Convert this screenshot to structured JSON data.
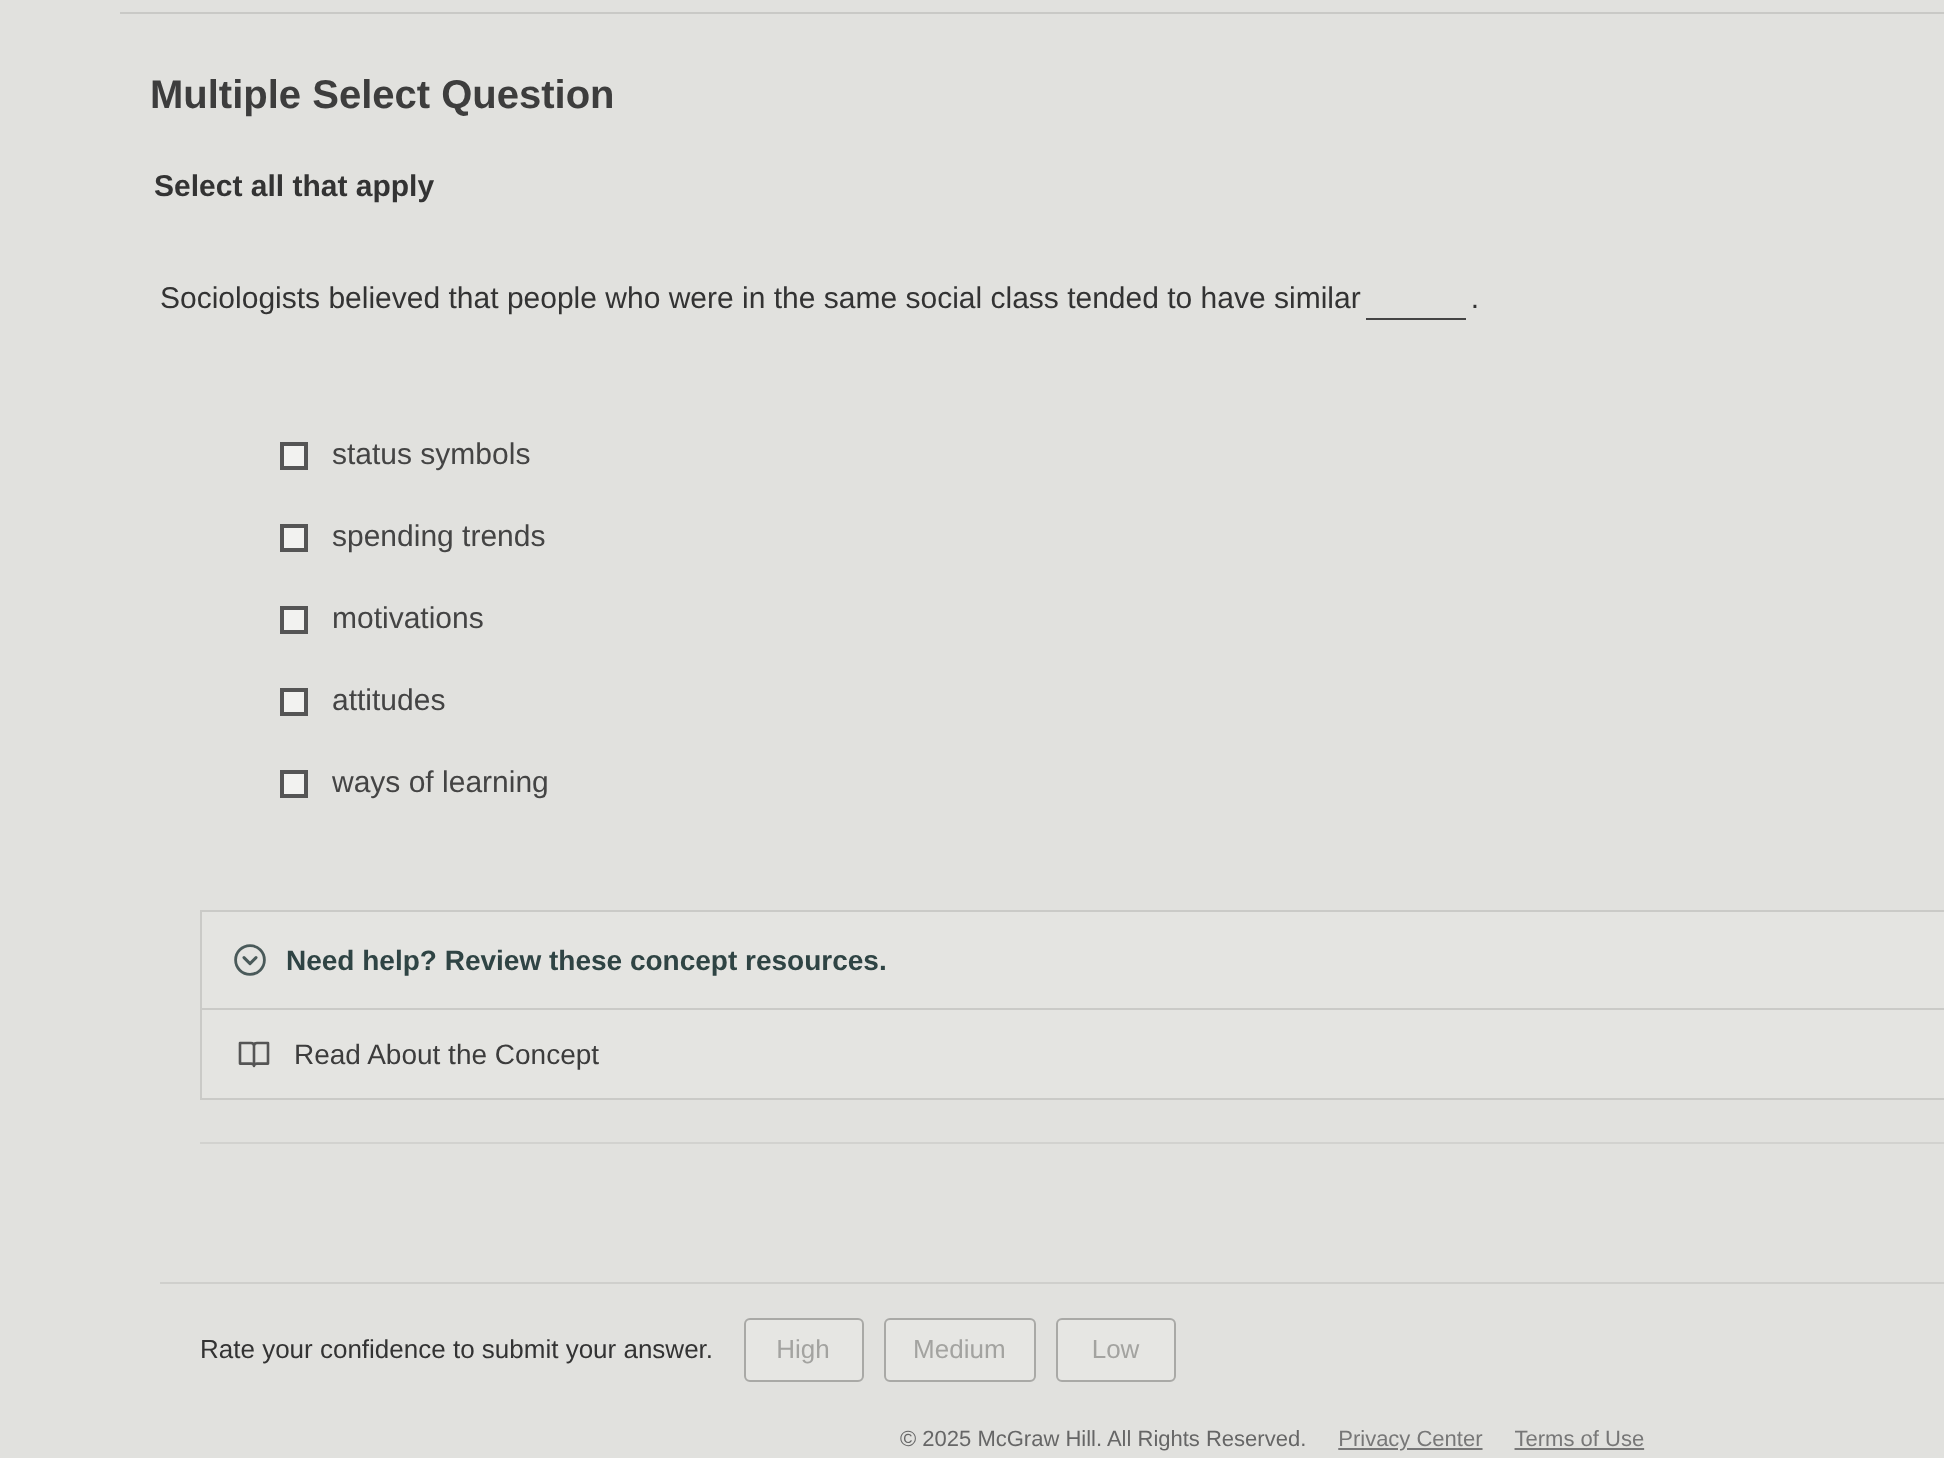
{
  "heading": "Multiple Select Question",
  "instruction": "Select all that apply",
  "question": {
    "text": "Sociologists believed that people who were in the same social class tended to have similar",
    "end": "."
  },
  "options": [
    {
      "label": "status symbols",
      "checked": false
    },
    {
      "label": "spending trends",
      "checked": false
    },
    {
      "label": "motivations",
      "checked": false
    },
    {
      "label": "attitudes",
      "checked": false
    },
    {
      "label": "ways of learning",
      "checked": false
    }
  ],
  "help": {
    "expanded": true,
    "title": "Need help? Review these concept resources.",
    "resources": [
      {
        "label": "Read About the Concept"
      }
    ]
  },
  "confidence": {
    "prompt": "Rate your confidence to submit your answer.",
    "buttons": [
      {
        "label": "High",
        "disabled": true
      },
      {
        "label": "Medium",
        "disabled": true
      },
      {
        "label": "Low",
        "disabled": true
      }
    ]
  },
  "footer": {
    "copyright": "© 2025 McGraw Hill. All Rights Reserved.",
    "links": [
      "Privacy Center",
      "Terms of Use"
    ]
  }
}
